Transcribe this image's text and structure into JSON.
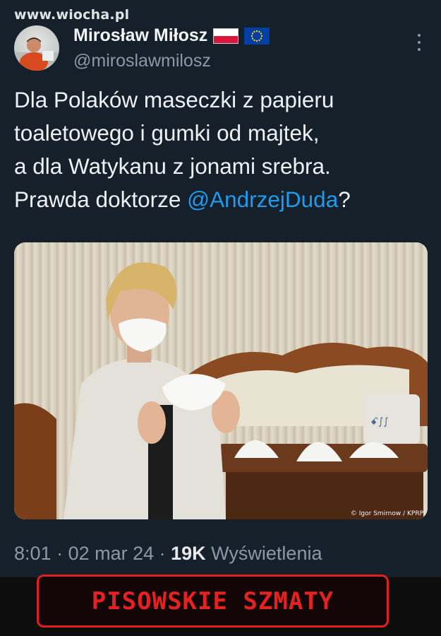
{
  "watermark": "www.wiocha.pl",
  "author": {
    "name": "Mirosław Miłosz",
    "handle": "@miroslawmilosz",
    "flags": [
      "poland-flag-icon",
      "eu-flag-icon"
    ]
  },
  "tweet": {
    "text": "Dla Polaków maseczki z papieru\ntoaletowego i gumki od majtek,\na dla Watykanu z jonami srebra.\nPrawda doktorze ",
    "mention": "@AndrzejDuda",
    "suffix": "?"
  },
  "media": {
    "credit": "© Igor Smirnow / KPRP"
  },
  "meta": {
    "time": "8:01",
    "sep1": " · ",
    "date": "02 mar 24",
    "sep2": " · ",
    "views": "19K",
    "views_label": " Wyświetlenia"
  },
  "banner": {
    "text": "PISOWSKIE SZMATY"
  },
  "colors": {
    "background": "#15202b",
    "link": "#1d9bf0",
    "muted": "#8b98a5",
    "banner": "#e52222"
  }
}
